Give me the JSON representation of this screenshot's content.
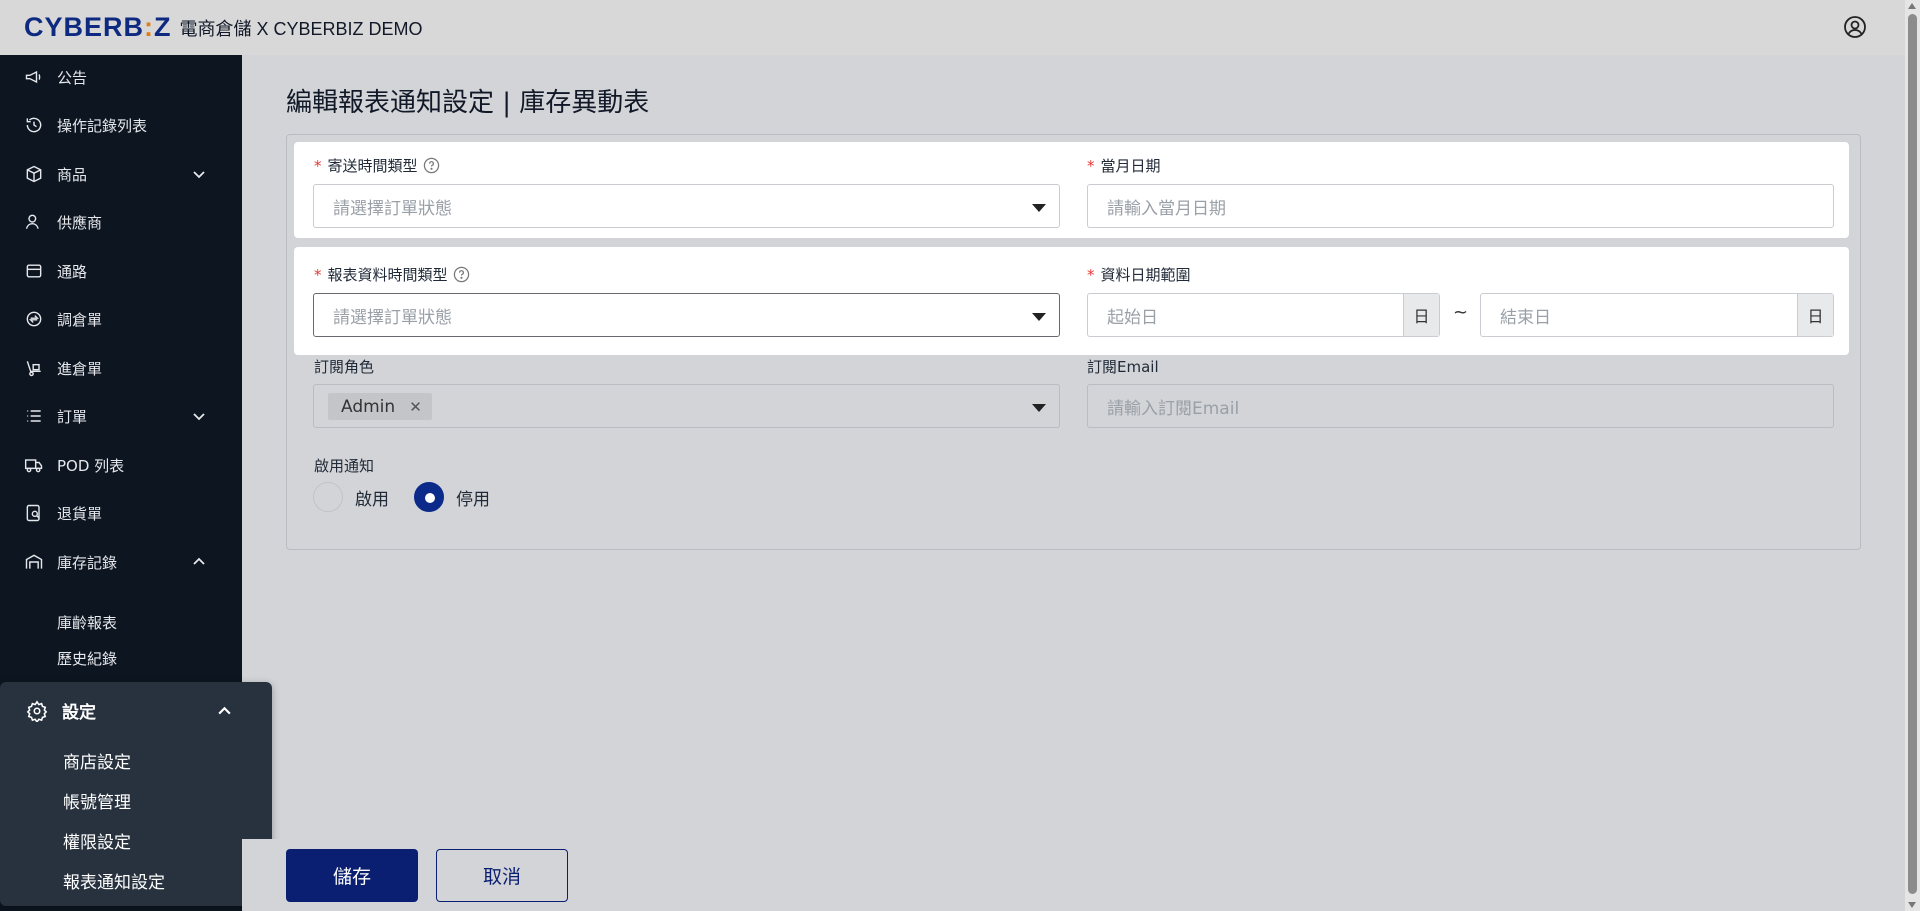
{
  "header": {
    "logo_main": "CYBERB",
    "logo_dot": ":",
    "logo_end": "Z",
    "app_title": "電商倉儲 X CYBERBIZ DEMO"
  },
  "sidebar": {
    "items": [
      {
        "label": "公告",
        "icon": "megaphone-icon"
      },
      {
        "label": "操作記錄列表",
        "icon": "history-icon"
      },
      {
        "label": "商品",
        "icon": "box-icon"
      },
      {
        "label": "供應商",
        "icon": "user-icon"
      },
      {
        "label": "通路",
        "icon": "store-icon"
      },
      {
        "label": "調倉單",
        "icon": "transfer-icon"
      },
      {
        "label": "進倉單",
        "icon": "dolly-icon"
      },
      {
        "label": "訂單",
        "icon": "list-icon"
      },
      {
        "label": "POD 列表",
        "icon": "truck-icon"
      },
      {
        "label": "退貨單",
        "icon": "return-icon"
      },
      {
        "label": "庫存記錄",
        "icon": "warehouse-icon"
      }
    ],
    "inventory_sub": [
      "庫齡報表",
      "歷史紀錄"
    ],
    "settings": {
      "label": "設定",
      "items": [
        "商店設定",
        "帳號管理",
        "權限設定",
        "報表通知設定"
      ]
    }
  },
  "page": {
    "title": "編輯報表通知設定 | 庫存異動表"
  },
  "form": {
    "send_time_type": {
      "label": "寄送時間類型",
      "placeholder": "請選擇訂單狀態"
    },
    "month_date": {
      "label": "當月日期",
      "placeholder": "請輸入當月日期"
    },
    "report_time_type": {
      "label": "報表資料時間類型",
      "placeholder": "請選擇訂單狀態"
    },
    "date_range": {
      "label": "資料日期範圍",
      "start_placeholder": "起始日",
      "end_placeholder": "結束日",
      "addon": "日",
      "separator": "~"
    },
    "subscribe_role": {
      "label": "訂閱角色",
      "tags": [
        "Admin"
      ]
    },
    "subscribe_email": {
      "label": "訂閱Email",
      "placeholder": "請輸入訂閱Email"
    },
    "enable_notice": {
      "label": "啟用通知",
      "options": [
        "啟用",
        "停用"
      ],
      "selected": "停用"
    }
  },
  "actions": {
    "save": "儲存",
    "cancel": "取消"
  },
  "colors": {
    "brand": "#0d2a80",
    "primary_button": "#0b1f72",
    "required": "#e53935"
  }
}
